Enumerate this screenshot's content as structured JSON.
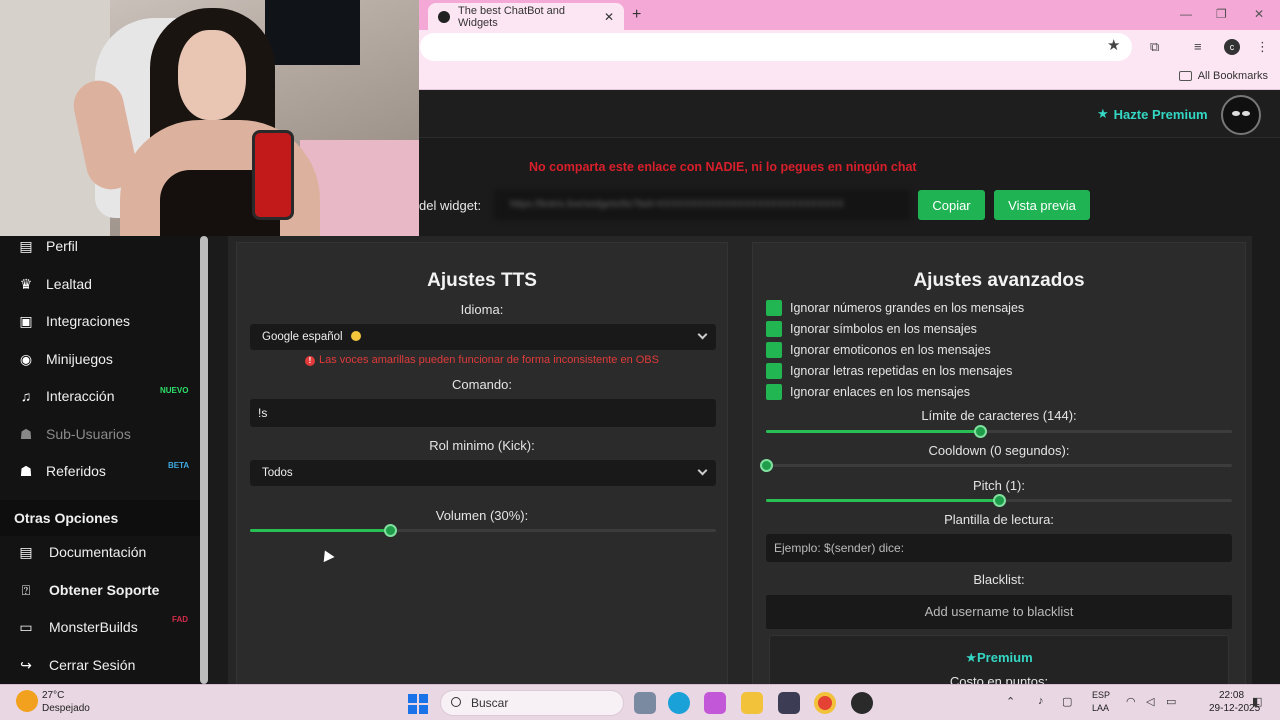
{
  "browser": {
    "tab_title": "The best ChatBot and Widgets",
    "tab_close": "✕",
    "new_tab": "+",
    "profile_letter": "c",
    "bookmarks_label": "All Bookmarks",
    "star": "★",
    "minimize": "—",
    "maximize": "❐",
    "close": "✕"
  },
  "header": {
    "premium_link": "Hazte Premium",
    "warning": "No comparta este enlace con NADIE, ni lo pegues en ningún chat",
    "widget_label": "del widget:",
    "widget_url": "https://botrix.live/widgets/tts?bid=XXXXXXXXXXXXXXXXXXXXXXXXXXXX",
    "copy_button": "Copiar",
    "preview_button": "Vista previa"
  },
  "sidebar": {
    "items": [
      {
        "label": "Perfil",
        "icon": "id-card-icon",
        "glyph": "▤"
      },
      {
        "label": "Lealtad",
        "icon": "trophy-icon",
        "glyph": "🏆"
      },
      {
        "label": "Integraciones",
        "icon": "integrations-icon",
        "glyph": "▣"
      },
      {
        "label": "Minijuegos",
        "icon": "gamepad-icon",
        "glyph": "◉"
      },
      {
        "label": "Interacción",
        "icon": "music-icon",
        "glyph": "♫",
        "badge": "NUEVO"
      },
      {
        "label": "Sub-Usuarios",
        "icon": "users-icon",
        "glyph": "👥"
      },
      {
        "label": "Referidos",
        "icon": "referrals-icon",
        "glyph": "👥",
        "badge": "BETA"
      }
    ],
    "other_title": "Otras Opciones",
    "other_items": [
      {
        "label": "Documentación",
        "icon": "document-icon",
        "glyph": "▤"
      },
      {
        "label": "Obtener Soporte",
        "icon": "help-icon",
        "glyph": "?"
      },
      {
        "label": "MonsterBuilds",
        "icon": "laptop-icon",
        "glyph": "▭",
        "badge": "FAD"
      },
      {
        "label": "Cerrar Sesión",
        "icon": "logout-icon",
        "glyph": "↪"
      }
    ]
  },
  "tts": {
    "title": "Ajustes TTS",
    "language_label": "Idioma:",
    "language_value": "Google español",
    "language_note": "Las voces amarillas pueden funcionar de forma inconsistente en OBS",
    "command_label": "Comando:",
    "command_value": "!s",
    "role_label": "Rol minimo (Kick):",
    "role_value": "Todos",
    "volume_label": "Volumen (30%):",
    "volume_value": 0.3
  },
  "advanced": {
    "title": "Ajustes avanzados",
    "checkboxes": [
      "Ignorar números grandes en los mensajes",
      "Ignorar símbolos en los mensajes",
      "Ignorar emoticonos en los mensajes",
      "Ignorar letras repetidas en los mensajes",
      "Ignorar enlaces en los mensajes"
    ],
    "char_limit_label": "Límite de caracteres (144):",
    "char_limit_value": 0.46,
    "cooldown_label": "Cooldown (0 segundos):",
    "cooldown_value": 0,
    "pitch_label": "Pitch (1):",
    "pitch_value": 0.5,
    "template_label": "Plantilla de lectura:",
    "template_placeholder": "Ejemplo: $(sender) dice:",
    "blacklist_label": "Blacklist:",
    "blacklist_placeholder": "Add username to blacklist",
    "premium_title": "Premium",
    "premium_cost": "Costo en puntos:"
  },
  "taskbar": {
    "temp": "27°C",
    "weather": "Despejado",
    "search": "Buscar",
    "lang1": "ESP",
    "lang2": "LAA",
    "time": "22:08",
    "date": "29-12-2025"
  },
  "colors": {
    "accent_green": "#1fb354",
    "premium_teal": "#34d7c4",
    "warning_red": "#d81f2b",
    "chrome_pink": "#f4a8d6"
  }
}
